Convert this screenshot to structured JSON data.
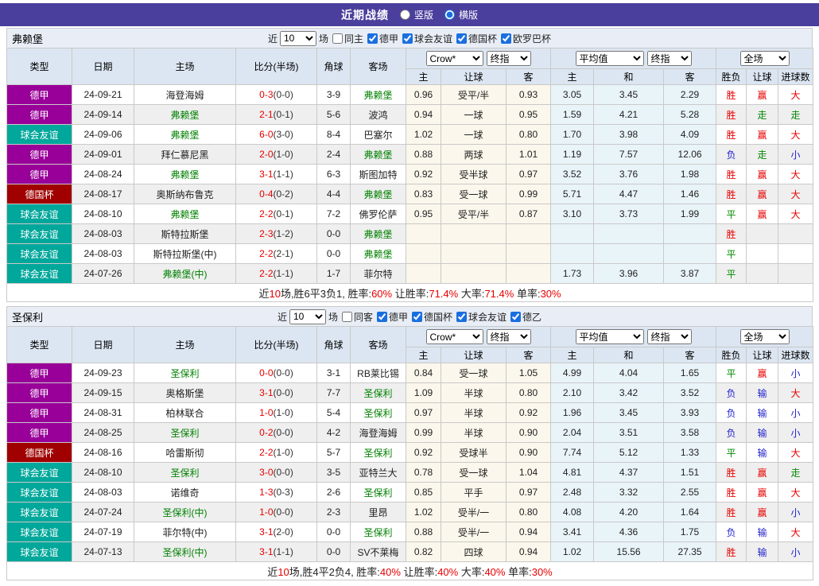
{
  "title_bar": {
    "title": "近期战绩",
    "radio_options": [
      {
        "label": "竖版",
        "selected": false
      },
      {
        "label": "横版",
        "selected": true
      }
    ]
  },
  "colors": {
    "title_bar_bg": "#4a3f9d",
    "league": {
      "德甲": "#990099",
      "球会友谊": "#00a79b",
      "德国杯": "#a00000"
    },
    "focus_team": "#008000",
    "win": "#e60000",
    "draw": "#008800",
    "lose": "#2222cc",
    "crow_bg": "#fcf7ec",
    "avg_bg": "#e9f4f9"
  },
  "header": {
    "static_cols": [
      "类型",
      "日期",
      "主场",
      "比分(半场)",
      "角球",
      "客场"
    ],
    "sub_cols": [
      "主",
      "让球",
      "客",
      "主",
      "和",
      "客",
      "胜负",
      "让球",
      "进球数"
    ],
    "groups": [
      {
        "selects": [
          "Crow*",
          "终指"
        ]
      },
      {
        "selects": [
          "平均值",
          "终指"
        ]
      },
      {
        "selects": [
          "全场"
        ]
      }
    ]
  },
  "tables": [
    {
      "team": "弗赖堡",
      "filter": {
        "prefix": "近",
        "count": "10",
        "suffix": "场",
        "same_label": "同主",
        "same_checked": false,
        "leagues": [
          "德甲",
          "球会友谊",
          "德国杯",
          "欧罗巴杯"
        ]
      },
      "rows": [
        {
          "league": "德甲",
          "date": "24-09-21",
          "home": "海登海姆",
          "hf": false,
          "score": "0-3",
          "half": "(0-0)",
          "corner": "3-9",
          "away": "弗赖堡",
          "af": true,
          "crow": [
            "0.96",
            "受平/半",
            "0.93"
          ],
          "avg": [
            "3.05",
            "3.45",
            "2.29"
          ],
          "res": [
            [
              "胜",
              "w"
            ],
            [
              "赢",
              "w"
            ],
            [
              "大",
              "w"
            ]
          ]
        },
        {
          "league": "德甲",
          "date": "24-09-14",
          "home": "弗赖堡",
          "hf": true,
          "score": "2-1",
          "half": "(0-1)",
          "corner": "5-6",
          "away": "波鸿",
          "af": false,
          "crow": [
            "0.94",
            "一球",
            "0.95"
          ],
          "avg": [
            "1.59",
            "4.21",
            "5.28"
          ],
          "res": [
            [
              "胜",
              "w"
            ],
            [
              "走",
              "d"
            ],
            [
              "走",
              "d"
            ]
          ]
        },
        {
          "league": "球会友谊",
          "date": "24-09-06",
          "home": "弗赖堡",
          "hf": true,
          "score": "6-0",
          "half": "(3-0)",
          "corner": "8-4",
          "away": "巴塞尔",
          "af": false,
          "crow": [
            "1.02",
            "一球",
            "0.80"
          ],
          "avg": [
            "1.70",
            "3.98",
            "4.09"
          ],
          "res": [
            [
              "胜",
              "w"
            ],
            [
              "赢",
              "w"
            ],
            [
              "大",
              "w"
            ]
          ]
        },
        {
          "league": "德甲",
          "date": "24-09-01",
          "home": "拜仁慕尼黑",
          "hf": false,
          "score": "2-0",
          "half": "(1-0)",
          "corner": "2-4",
          "away": "弗赖堡",
          "af": true,
          "crow": [
            "0.88",
            "两球",
            "1.01"
          ],
          "avg": [
            "1.19",
            "7.57",
            "12.06"
          ],
          "res": [
            [
              "负",
              "l"
            ],
            [
              "走",
              "d"
            ],
            [
              "小",
              "l"
            ]
          ]
        },
        {
          "league": "德甲",
          "date": "24-08-24",
          "home": "弗赖堡",
          "hf": true,
          "score": "3-1",
          "half": "(1-1)",
          "corner": "6-3",
          "away": "斯图加特",
          "af": false,
          "crow": [
            "0.92",
            "受半球",
            "0.97"
          ],
          "avg": [
            "3.52",
            "3.76",
            "1.98"
          ],
          "res": [
            [
              "胜",
              "w"
            ],
            [
              "赢",
              "w"
            ],
            [
              "大",
              "w"
            ]
          ]
        },
        {
          "league": "德国杯",
          "date": "24-08-17",
          "home": "奥斯纳布鲁克",
          "hf": false,
          "score": "0-4",
          "half": "(0-2)",
          "corner": "4-4",
          "away": "弗赖堡",
          "af": true,
          "crow": [
            "0.83",
            "受一球",
            "0.99"
          ],
          "avg": [
            "5.71",
            "4.47",
            "1.46"
          ],
          "res": [
            [
              "胜",
              "w"
            ],
            [
              "赢",
              "w"
            ],
            [
              "大",
              "w"
            ]
          ]
        },
        {
          "league": "球会友谊",
          "date": "24-08-10",
          "home": "弗赖堡",
          "hf": true,
          "score": "2-2",
          "half": "(0-1)",
          "corner": "7-2",
          "away": "佛罗伦萨",
          "af": false,
          "crow": [
            "0.95",
            "受平/半",
            "0.87"
          ],
          "avg": [
            "3.10",
            "3.73",
            "1.99"
          ],
          "res": [
            [
              "平",
              "d"
            ],
            [
              "赢",
              "w"
            ],
            [
              "大",
              "w"
            ]
          ]
        },
        {
          "league": "球会友谊",
          "date": "24-08-03",
          "home": "斯特拉斯堡",
          "hf": false,
          "score": "2-3",
          "half": "(1-2)",
          "corner": "0-0",
          "away": "弗赖堡",
          "af": true,
          "crow": [
            "",
            "",
            ""
          ],
          "avg": [
            "",
            "",
            ""
          ],
          "res": [
            [
              "胜",
              "w"
            ],
            [
              "",
              ""
            ],
            [
              "",
              ""
            ]
          ]
        },
        {
          "league": "球会友谊",
          "date": "24-08-03",
          "home": "斯特拉斯堡(中)",
          "hf": false,
          "score": "2-2",
          "half": "(2-1)",
          "corner": "0-0",
          "away": "弗赖堡",
          "af": true,
          "crow": [
            "",
            "",
            ""
          ],
          "avg": [
            "",
            "",
            ""
          ],
          "res": [
            [
              "平",
              "d"
            ],
            [
              "",
              ""
            ],
            [
              "",
              ""
            ]
          ]
        },
        {
          "league": "球会友谊",
          "date": "24-07-26",
          "home": "弗赖堡(中)",
          "hf": true,
          "score": "2-2",
          "half": "(1-1)",
          "corner": "1-7",
          "away": "菲尔特",
          "af": false,
          "crow": [
            "",
            "",
            ""
          ],
          "avg": [
            "1.73",
            "3.96",
            "3.87"
          ],
          "res": [
            [
              "平",
              "d"
            ],
            [
              "",
              ""
            ],
            [
              "",
              ""
            ]
          ]
        }
      ],
      "summary": [
        [
          "近",
          0
        ],
        [
          "10",
          1
        ],
        [
          "场,胜6平3负1, 胜率:",
          0
        ],
        [
          "60%",
          1
        ],
        [
          " 让胜率:",
          0
        ],
        [
          "71.4%",
          1
        ],
        [
          " 大率:",
          0
        ],
        [
          "71.4%",
          1
        ],
        [
          " 单率:",
          0
        ],
        [
          "30%",
          1
        ]
      ]
    },
    {
      "team": "圣保利",
      "filter": {
        "prefix": "近",
        "count": "10",
        "suffix": "场",
        "same_label": "同客",
        "same_checked": false,
        "leagues": [
          "德甲",
          "德国杯",
          "球会友谊",
          "德乙"
        ]
      },
      "rows": [
        {
          "league": "德甲",
          "date": "24-09-23",
          "home": "圣保利",
          "hf": true,
          "score": "0-0",
          "half": "(0-0)",
          "corner": "3-1",
          "away": "RB莱比锡",
          "af": false,
          "crow": [
            "0.84",
            "受一球",
            "1.05"
          ],
          "avg": [
            "4.99",
            "4.04",
            "1.65"
          ],
          "res": [
            [
              "平",
              "d"
            ],
            [
              "赢",
              "w"
            ],
            [
              "小",
              "l"
            ]
          ]
        },
        {
          "league": "德甲",
          "date": "24-09-15",
          "home": "奥格斯堡",
          "hf": false,
          "score": "3-1",
          "half": "(0-0)",
          "corner": "7-7",
          "away": "圣保利",
          "af": true,
          "crow": [
            "1.09",
            "半球",
            "0.80"
          ],
          "avg": [
            "2.10",
            "3.42",
            "3.52"
          ],
          "res": [
            [
              "负",
              "l"
            ],
            [
              "输",
              "l"
            ],
            [
              "大",
              "w"
            ]
          ]
        },
        {
          "league": "德甲",
          "date": "24-08-31",
          "home": "柏林联合",
          "hf": false,
          "score": "1-0",
          "half": "(1-0)",
          "corner": "5-4",
          "away": "圣保利",
          "af": true,
          "crow": [
            "0.97",
            "半球",
            "0.92"
          ],
          "avg": [
            "1.96",
            "3.45",
            "3.93"
          ],
          "res": [
            [
              "负",
              "l"
            ],
            [
              "输",
              "l"
            ],
            [
              "小",
              "l"
            ]
          ]
        },
        {
          "league": "德甲",
          "date": "24-08-25",
          "home": "圣保利",
          "hf": true,
          "score": "0-2",
          "half": "(0-0)",
          "corner": "4-2",
          "away": "海登海姆",
          "af": false,
          "crow": [
            "0.99",
            "半球",
            "0.90"
          ],
          "avg": [
            "2.04",
            "3.51",
            "3.58"
          ],
          "res": [
            [
              "负",
              "l"
            ],
            [
              "输",
              "l"
            ],
            [
              "小",
              "l"
            ]
          ]
        },
        {
          "league": "德国杯",
          "date": "24-08-16",
          "home": "哈雷斯彻",
          "hf": false,
          "score": "2-2",
          "half": "(1-0)",
          "corner": "5-7",
          "away": "圣保利",
          "af": true,
          "crow": [
            "0.92",
            "受球半",
            "0.90"
          ],
          "avg": [
            "7.74",
            "5.12",
            "1.33"
          ],
          "res": [
            [
              "平",
              "d"
            ],
            [
              "输",
              "l"
            ],
            [
              "大",
              "w"
            ]
          ]
        },
        {
          "league": "球会友谊",
          "date": "24-08-10",
          "home": "圣保利",
          "hf": true,
          "score": "3-0",
          "half": "(0-0)",
          "corner": "3-5",
          "away": "亚特兰大",
          "af": false,
          "crow": [
            "0.78",
            "受一球",
            "1.04"
          ],
          "avg": [
            "4.81",
            "4.37",
            "1.51"
          ],
          "res": [
            [
              "胜",
              "w"
            ],
            [
              "赢",
              "w"
            ],
            [
              "走",
              "d"
            ]
          ]
        },
        {
          "league": "球会友谊",
          "date": "24-08-03",
          "home": "诺维奇",
          "hf": false,
          "score": "1-3",
          "half": "(0-3)",
          "corner": "2-6",
          "away": "圣保利",
          "af": true,
          "crow": [
            "0.85",
            "平手",
            "0.97"
          ],
          "avg": [
            "2.48",
            "3.32",
            "2.55"
          ],
          "res": [
            [
              "胜",
              "w"
            ],
            [
              "赢",
              "w"
            ],
            [
              "大",
              "w"
            ]
          ]
        },
        {
          "league": "球会友谊",
          "date": "24-07-24",
          "home": "圣保利(中)",
          "hf": true,
          "score": "1-0",
          "half": "(0-0)",
          "corner": "2-3",
          "away": "里昂",
          "af": false,
          "crow": [
            "1.02",
            "受半/一",
            "0.80"
          ],
          "avg": [
            "4.08",
            "4.20",
            "1.64"
          ],
          "res": [
            [
              "胜",
              "w"
            ],
            [
              "赢",
              "w"
            ],
            [
              "小",
              "l"
            ]
          ]
        },
        {
          "league": "球会友谊",
          "date": "24-07-19",
          "home": "菲尔特(中)",
          "hf": false,
          "score": "3-1",
          "half": "(2-0)",
          "corner": "0-0",
          "away": "圣保利",
          "af": true,
          "crow": [
            "0.88",
            "受半/一",
            "0.94"
          ],
          "avg": [
            "3.41",
            "4.36",
            "1.75"
          ],
          "res": [
            [
              "负",
              "l"
            ],
            [
              "输",
              "l"
            ],
            [
              "大",
              "w"
            ]
          ]
        },
        {
          "league": "球会友谊",
          "date": "24-07-13",
          "home": "圣保利(中)",
          "hf": true,
          "score": "3-1",
          "half": "(1-1)",
          "corner": "0-0",
          "away": "SV不莱梅",
          "af": false,
          "crow": [
            "0.82",
            "四球",
            "0.94"
          ],
          "avg": [
            "1.02",
            "15.56",
            "27.35"
          ],
          "res": [
            [
              "胜",
              "w"
            ],
            [
              "输",
              "l"
            ],
            [
              "小",
              "l"
            ]
          ]
        }
      ],
      "summary": [
        [
          "近",
          0
        ],
        [
          "10",
          1
        ],
        [
          "场,胜4平2负4, 胜率:",
          0
        ],
        [
          "40%",
          1
        ],
        [
          " 让胜率:",
          0
        ],
        [
          "40%",
          1
        ],
        [
          " 大率:",
          0
        ],
        [
          "40%",
          1
        ],
        [
          " 单率:",
          0
        ],
        [
          "30%",
          1
        ]
      ]
    }
  ]
}
